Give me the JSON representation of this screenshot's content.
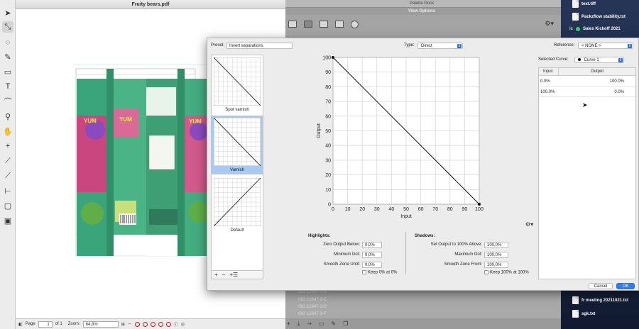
{
  "desktop": {
    "files": [
      {
        "label": "text.tiff",
        "icon": "file-icon"
      },
      {
        "label": "Packzflow stability.txt",
        "icon": "file-icon"
      },
      {
        "label": "Sales Kickoff 2021",
        "icon": "green-dot-icon"
      },
      {
        "label": "fr meeting 20211021.txt",
        "icon": "file-icon"
      },
      {
        "label": "sgk.txt",
        "icon": "file-icon"
      }
    ],
    "edge_text": "ix"
  },
  "pdf_window": {
    "title": "Fruity bears.pdf",
    "status": {
      "page_label": "Page",
      "page_value": "1",
      "page_of": "of 1",
      "zoom_label": "Zoom:",
      "zoom_value": "64,8%"
    }
  },
  "palette_dock": {
    "title": "Palette Dock",
    "subtitle": "View Options",
    "iso_items": [
      "ISO 12647-2-B",
      "ISO 12647-2-C",
      "ISO 12647-2-D",
      "ISO 12647-2-F"
    ]
  },
  "dialog": {
    "preset_label": "Preset:",
    "preset_value": "Invert separations",
    "type_label": "Type:",
    "type_value": "Direct",
    "reference_label": "Reference:",
    "reference_value": "< NONE >",
    "selected_curve_label": "Selected Curve:",
    "selected_curve_value": "Curve 1",
    "presets": [
      {
        "name": "Spot varnish",
        "curve": "inverse"
      },
      {
        "name": "Varnish",
        "curve": "inverse"
      },
      {
        "name": "Default",
        "curve": "identity"
      }
    ],
    "table": {
      "col_input": "Input",
      "col_output": "Output",
      "rows": [
        {
          "input": "0.0%",
          "output": "100.0%"
        },
        {
          "input": "100.0%",
          "output": "0.0%"
        }
      ]
    },
    "highlights": {
      "title": "Highlights:",
      "zero_output_label": "Zero Output Below:",
      "zero_output_value": "0,0%",
      "min_dot_label": "Minimum Dot:",
      "min_dot_value": "0,0%",
      "smooth_until_label": "Smooth Zone Until:",
      "smooth_until_value": "0,0%",
      "keep_label": "Keep 0% at 0%"
    },
    "shadows": {
      "title": "Shadows:",
      "set_output_label": "Set Output to 100% Above:",
      "set_output_value": "100,0%",
      "max_dot_label": "Maximum Dot:",
      "max_dot_value": "100,0%",
      "smooth_from_label": "Smooth Zone From:",
      "smooth_from_value": "100,0%",
      "keep_label": "Keep 100% at 100%"
    },
    "buttons": {
      "cancel": "Cancel",
      "ok": "OK"
    }
  },
  "chart_data": {
    "type": "line",
    "xlabel": "Input",
    "ylabel": "Output",
    "xlim": [
      0,
      100
    ],
    "ylim": [
      0,
      100
    ],
    "xticks": [
      0,
      10,
      20,
      30,
      40,
      50,
      60,
      70,
      80,
      90,
      100
    ],
    "yticks": [
      0,
      10,
      20,
      30,
      40,
      50,
      60,
      70,
      80,
      90,
      100
    ],
    "grid": true,
    "series": [
      {
        "points": [
          [
            0,
            100
          ],
          [
            100,
            0
          ]
        ],
        "color": "#000000"
      }
    ]
  }
}
